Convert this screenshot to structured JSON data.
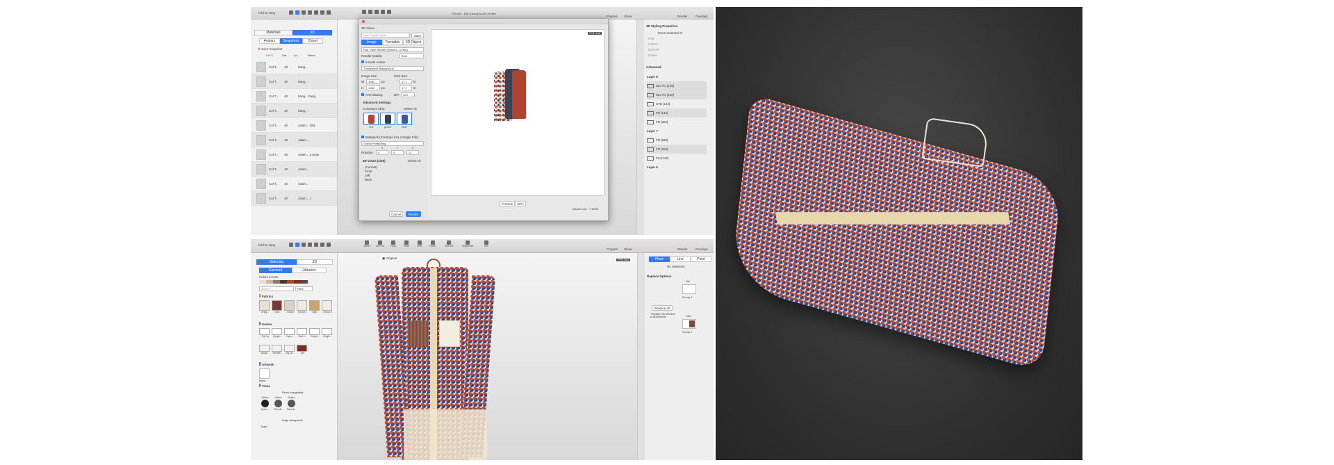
{
  "top": {
    "toolbar": {
      "project": "Fold & Hang",
      "window_title": "Render - fold & hang-3d-bin of start",
      "right_buttons": [
        "Prepare",
        "Show",
        "Render",
        "Overlays"
      ]
    },
    "left_panel": {
      "tabs": [
        "Materials",
        "3D"
      ],
      "subtabs": [
        "Avatars",
        "Snapshots",
        "Closet"
      ],
      "save_label": "Save Snapshot",
      "columns": [
        "Col T...",
        "Dat...",
        "An...",
        "Name"
      ],
      "rows": [
        {
          "c": "Col T...",
          "d": "40",
          "n": "hang..."
        },
        {
          "c": "Col T...",
          "d": "40",
          "n": "hang..."
        },
        {
          "c": "Col T...",
          "d": "40",
          "n": "hang... hang"
        },
        {
          "c": "Col T...",
          "d": "40",
          "n": "hang..."
        },
        {
          "c": "Col T...",
          "d": "40",
          "n": "Adam... fold"
        },
        {
          "c": "Col T...",
          "d": "40",
          "n": "Adam..."
        },
        {
          "c": "Col T...",
          "d": "40",
          "n": "Adam... a pose"
        },
        {
          "c": "Col T...",
          "d": "40",
          "n": "Adam..."
        },
        {
          "c": "Col T...",
          "d": "40",
          "n": "Adam..."
        },
        {
          "c": "Col T...",
          "d": "40",
          "n": "Adam... 1"
        }
      ]
    },
    "dialog": {
      "views_label": "3D Views",
      "preset": "New Export Preset",
      "save": "Save",
      "tabs": [
        "Image",
        "Turntable",
        "3D Object"
      ],
      "render_engine": "Ray Trace Render (Render - V-Ray)",
      "quality_label": "Render Quality",
      "quality_value": "Best",
      "include_avatar": "Include Avatar",
      "background": "Transparent Background",
      "image_size": "Image Size",
      "print_size": "Print Size",
      "w_label": "W",
      "w_value": "1080",
      "h_label": "H",
      "h_value": "1080",
      "px": "px",
      "in_w": "17.7",
      "in_h": "17.7",
      "unit": "in",
      "antialias": "Anti-aliasing",
      "dpi_label": "DPI",
      "dpi_value": "300",
      "advanced": "Advanced Settings",
      "colorways": "Colorways (3/3)",
      "select_all": "Select All",
      "colorway_items": [
        {
          "name": "red",
          "color": "#b8442d"
        },
        {
          "name": "green",
          "color": "#36414f"
        },
        {
          "name": "blue",
          "color": "#3b5aa0"
        }
      ],
      "multipack": "Multipack (Combine into a Single File)",
      "positioning": "Global Positioning",
      "rotation": "Rotation",
      "axes": [
        "X",
        "Y",
        "Z"
      ],
      "rot_vals": [
        "0",
        "0",
        "12"
      ],
      "views_count": "3D Views (1/26)",
      "views": [
        "(Current)",
        "Front",
        "Left",
        "Back"
      ],
      "cancel": "Cancel",
      "render": "Render",
      "preview": "Preview",
      "zoom": "60%",
      "upload": "Upload cost: ~7,6086",
      "fps": "FPS: 1.00"
    },
    "right_panel": {
      "title": "3D Styling Properties",
      "sub": "Items Selected: 0",
      "options": [
        "Hide",
        "Flatten",
        "Refresh",
        "Delete"
      ],
      "advanced": "Advanced",
      "layers": [
        {
          "h": "Layer 8"
        },
        {
          "n": "SLV PL [139]",
          "s": true
        },
        {
          "n": "SLV PL [140]",
          "s": true
        },
        {
          "n": "STD [143]"
        },
        {
          "n": "FR [144]",
          "s": true
        },
        {
          "n": "FR [202]"
        },
        {
          "h": "Layer 7"
        },
        {
          "n": "FR [286]"
        },
        {
          "n": "FR [263]",
          "s": true
        },
        {
          "n": "CO [142]"
        },
        {
          "h": "Layer 6"
        }
      ]
    }
  },
  "bottom": {
    "toolbar": {
      "project": "Fold & Hang",
      "tools": [
        "Select",
        "3D Pick",
        "Drop",
        "Pinch",
        "Shell",
        "Notch",
        "Sew 3D",
        "Snapshots",
        "mel"
      ],
      "right_buttons": [
        "Prepare",
        "Show",
        "Render",
        "Overlays"
      ]
    },
    "left_panel": {
      "tabs": [
        "Materials",
        "3D"
      ],
      "subtabs": [
        "Garment",
        "Libraries"
      ],
      "colors_label": "Colors in Use:",
      "search": "Search",
      "filter": "Filter",
      "fabrics_label": "Fabrics",
      "fabrics": [
        "Unkg...",
        "Twill...",
        "Cotaul",
        "Group 1",
        "Twill...",
        "Group 2"
      ],
      "seams_label": "Seams",
      "seams": [
        "Pg Zig",
        "Single...",
        "Nylo...",
        "Self-b...",
        "Single...",
        "Single..."
      ],
      "stitch": [
        "Single...",
        "Needle...",
        "Zig Za...",
        "left"
      ],
      "artwork_label": "Artwork",
      "artwork": [
        "Boast..."
      ],
      "trims_label": "Trims",
      "piece_assignable": "Piece Assignable",
      "button_types": [
        "Button",
        "Button",
        "Button"
      ],
      "trim_names": [
        "Nylon...",
        "Pierrcit...",
        "Pierrcit..."
      ],
      "edge_assignable": "Edge Assignable",
      "zipper": "Zipper"
    },
    "viewport": {
      "mode": "Original",
      "fps": "FPS: 30.0"
    },
    "right_panel": {
      "tabs": [
        "Piece",
        "Line",
        "Point"
      ],
      "no_selection": "No Selection",
      "replace_label": "Replace Options",
      "old": "Old",
      "group1": "Group 1",
      "replace_btn": "Replace All",
      "replace_note": "* Replace Old with New on all elements",
      "new": "New",
      "group2": "Group 2"
    }
  }
}
